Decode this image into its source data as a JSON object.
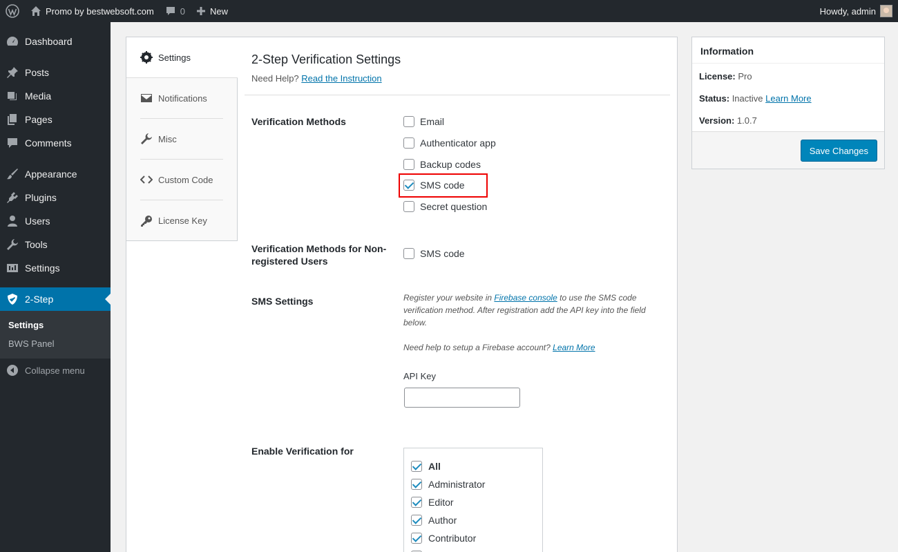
{
  "adminbar": {
    "site_name": "Promo by bestwebsoft.com",
    "comments_count": "0",
    "new_label": "New",
    "howdy": "Howdy, admin"
  },
  "sidebar": {
    "items": [
      {
        "label": "Dashboard",
        "icon": "dashboard-icon"
      },
      {
        "label": "Posts",
        "icon": "pin-icon"
      },
      {
        "label": "Media",
        "icon": "media-icon"
      },
      {
        "label": "Pages",
        "icon": "pages-icon"
      },
      {
        "label": "Comments",
        "icon": "comment-icon"
      },
      {
        "label": "Appearance",
        "icon": "brush-icon"
      },
      {
        "label": "Plugins",
        "icon": "plug-icon"
      },
      {
        "label": "Users",
        "icon": "user-icon"
      },
      {
        "label": "Tools",
        "icon": "wrench-icon"
      },
      {
        "label": "Settings",
        "icon": "settings-icon"
      },
      {
        "label": "2-Step",
        "icon": "shield-icon"
      }
    ],
    "submenu": [
      {
        "label": "Settings"
      },
      {
        "label": "BWS Panel"
      }
    ],
    "collapse_label": "Collapse menu"
  },
  "tabs": [
    {
      "label": "Settings",
      "icon": "gear-icon"
    },
    {
      "label": "Notifications",
      "icon": "envelope-icon"
    },
    {
      "label": "Misc",
      "icon": "wrench-icon"
    },
    {
      "label": "Custom Code",
      "icon": "code-icon"
    },
    {
      "label": "License Key",
      "icon": "key-icon"
    }
  ],
  "settings": {
    "title": "2-Step Verification Settings",
    "need_help": "Need Help?",
    "read_instruction": "Read the Instruction",
    "verification_methods_label": "Verification Methods",
    "methods": [
      {
        "label": "Email",
        "checked": false
      },
      {
        "label": "Authenticator app",
        "checked": false
      },
      {
        "label": "Backup codes",
        "checked": false
      },
      {
        "label": "SMS code",
        "checked": true
      },
      {
        "label": "Secret question",
        "checked": false
      }
    ],
    "nonreg_label": "Verification Methods for Non-registered Users",
    "nonreg_method": {
      "label": "SMS code",
      "checked": false
    },
    "sms_settings_label": "SMS Settings",
    "sms_desc_1a": "Register your website in ",
    "sms_desc_1_link": "Firebase console",
    "sms_desc_1b": " to use the SMS code verification method. After registration add the API key into the field below.",
    "sms_desc_2a": "Need help to setup a Firebase account? ",
    "sms_desc_2_link": "Learn More",
    "api_key_label": "API Key",
    "api_key_value": "",
    "enable_for_label": "Enable Verification for",
    "roles": [
      {
        "label": "All",
        "checked": true
      },
      {
        "label": "Administrator",
        "checked": true
      },
      {
        "label": "Editor",
        "checked": true
      },
      {
        "label": "Author",
        "checked": true
      },
      {
        "label": "Contributor",
        "checked": true
      }
    ]
  },
  "info": {
    "title": "Information",
    "license_key": "License:",
    "license_value": "Pro",
    "status_key": "Status:",
    "status_value": "Inactive",
    "status_link": "Learn More",
    "version_key": "Version:",
    "version_value": "1.0.7",
    "save_label": "Save Changes"
  },
  "colors": {
    "accent": "#0073aa",
    "sidebar_bg": "#23282d",
    "highlight": "#e00000"
  }
}
